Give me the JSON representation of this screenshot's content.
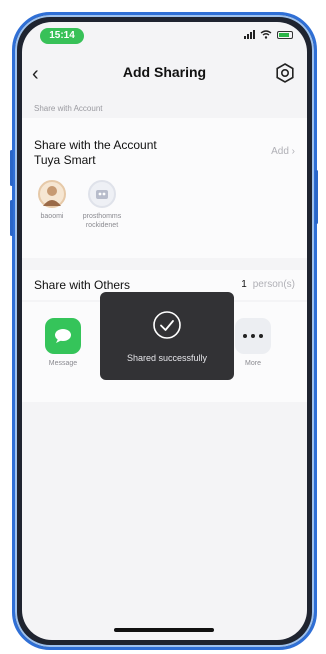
{
  "status_bar": {
    "time": "15:14"
  },
  "header": {
    "title": "Add Sharing"
  },
  "account_section": {
    "label": "Share with Account",
    "title_line1": "Share with the Account",
    "title_line2": "Tuya Smart",
    "add_label": "Add ›",
    "contacts": [
      {
        "name": "baoomi"
      },
      {
        "name": "prosthomms\nrockidenet"
      }
    ]
  },
  "others_section": {
    "title": "Share with Others",
    "count": "1",
    "count_unit": "person(s)"
  },
  "share_apps": [
    {
      "label": "Message",
      "icon": "message-icon"
    },
    {
      "label": "More",
      "icon": "more-icon"
    }
  ],
  "toast": {
    "text": "Shared successfully",
    "icon": "check-circle-icon"
  },
  "colors": {
    "accent_green": "#38c158",
    "frame_blue": "#2f6fd6",
    "toast_bg": "#222226"
  }
}
